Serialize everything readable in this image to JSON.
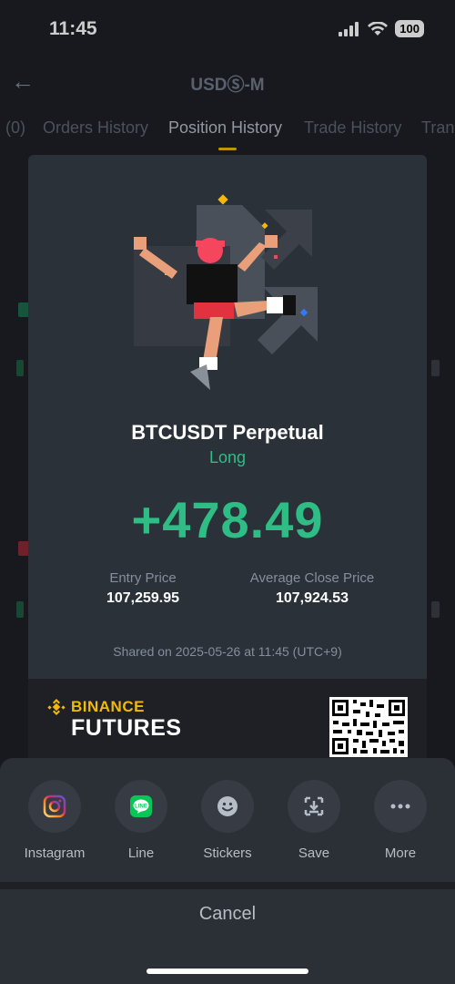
{
  "status": {
    "time": "11:45",
    "battery": "100"
  },
  "nav": {
    "title": "USDⓈ-M"
  },
  "tabs": [
    {
      "label": "(0)"
    },
    {
      "label": "Orders History"
    },
    {
      "label": "Position History"
    },
    {
      "label": "Trade History"
    },
    {
      "label": "Tran"
    }
  ],
  "card": {
    "symbol": "BTCUSDT Perpetual",
    "side": "Long",
    "pnl": "+478.49",
    "entry_label": "Entry Price",
    "entry_value": "107,259.95",
    "close_label": "Average Close Price",
    "close_value": "107,924.53",
    "shared": "Shared on 2025-05-26 at 11:45 (UTC+9)",
    "brand_top": "BINANCE",
    "brand_bottom": "FUTURES"
  },
  "share_options": [
    {
      "label": "Instagram",
      "icon": "instagram-icon"
    },
    {
      "label": "Line",
      "icon": "line-icon"
    },
    {
      "label": "Stickers",
      "icon": "stickers-icon"
    },
    {
      "label": "Save",
      "icon": "save-icon"
    },
    {
      "label": "More",
      "icon": "more-icon"
    }
  ],
  "cancel_label": "Cancel",
  "colors": {
    "accent": "#f0b90b",
    "positive": "#2ebd85",
    "negative": "#f6465d"
  }
}
